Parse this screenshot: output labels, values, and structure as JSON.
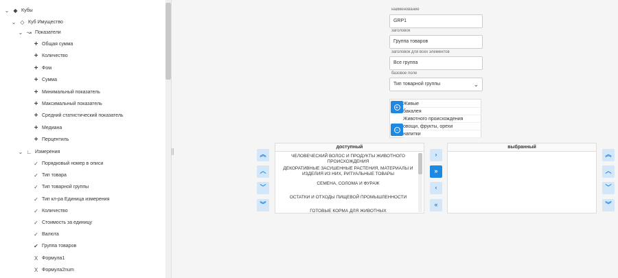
{
  "tree": {
    "root": {
      "label": "Кубы",
      "icon": "cubes-icon"
    },
    "cube": {
      "label": "Куб Имущество",
      "icon": "cube-icon"
    },
    "indicators": {
      "label": "Показатели",
      "icon": "line-chart-icon",
      "items": [
        "Общая сумма",
        "Количество",
        "Фом",
        "Сумма",
        "Минимальный показатель",
        "Максимальный показатель",
        "Средний статистический показатель",
        "Медиана",
        "Перцентиль"
      ]
    },
    "dimensions": {
      "label": "Измерения",
      "icon": "axis-icon",
      "items": [
        {
          "label": "Порядковый номер в описи",
          "icon": "check-icon"
        },
        {
          "label": "Тип товара",
          "icon": "check-icon"
        },
        {
          "label": "Тип товарной группы",
          "icon": "check-icon"
        },
        {
          "label": "Тип кл-ра Единица измерения",
          "icon": "check-icon"
        },
        {
          "label": "Количество",
          "icon": "check-icon"
        },
        {
          "label": "Стоимость за единицу",
          "icon": "check-icon"
        },
        {
          "label": "Валюта",
          "icon": "check-icon"
        },
        {
          "label": "Группа товаров",
          "icon": "double-check-icon"
        },
        {
          "label": "Формула1",
          "icon": "formula-icon"
        },
        {
          "label": "Формула2num",
          "icon": "formula-icon"
        }
      ]
    }
  },
  "form": {
    "name_label": "наименование",
    "name_value": "GRP1",
    "header_label": "заголовок",
    "header_value": "Группа товаров",
    "all_label": "заголовок для всех элементов",
    "all_value": "Все группа",
    "base_label": "базовое поле",
    "base_value": "Тип товарной группы"
  },
  "picker": {
    "values": [
      "Живые",
      "бакалея",
      "Животного происхождения",
      "овощи, фрукты, орехи",
      "напитки"
    ]
  },
  "dual_list": {
    "available_title": "доступный",
    "selected_title": "выбранный",
    "available_items": [
      "ЧЕЛОВЕЧЕСКИЙ ВОЛОС И ПРОДУКТЫ ЖИВОТНОГО ПРОИСХОЖДЕНИЯ",
      "ДЕКОРАТИВНЫЕ ЗАСУШЕННЫЕ РАСТЕНИЯ, МАТЕРИАЛЫ И ИЗДЕЛИЯ ИЗ НИХ, РИТУАЛЬНЫЕ ТОВАРЫ",
      "СЕМЕНА, СОЛОМА И ФУРАЖ",
      "ОСТАТКИ И ОТХОДЫ ПИЩЕВОЙ ПРОМЫШЛЕННОСТИ",
      "ГОТОВЫЕ КОРМА ДЛЯ ЖИВОТНЫХ"
    ],
    "selected_items": []
  },
  "glyphs": {
    "move_top": "⌃",
    "move_up": "›",
    "move_right_all": "»",
    "move_left": "‹",
    "move_left_all": "«",
    "expanded": "⌄",
    "plus": "+",
    "minus": "−",
    "chevron_down": "⌄"
  },
  "colors": {
    "accent": "#1e88e5",
    "accent_light": "#d4e7f8"
  }
}
